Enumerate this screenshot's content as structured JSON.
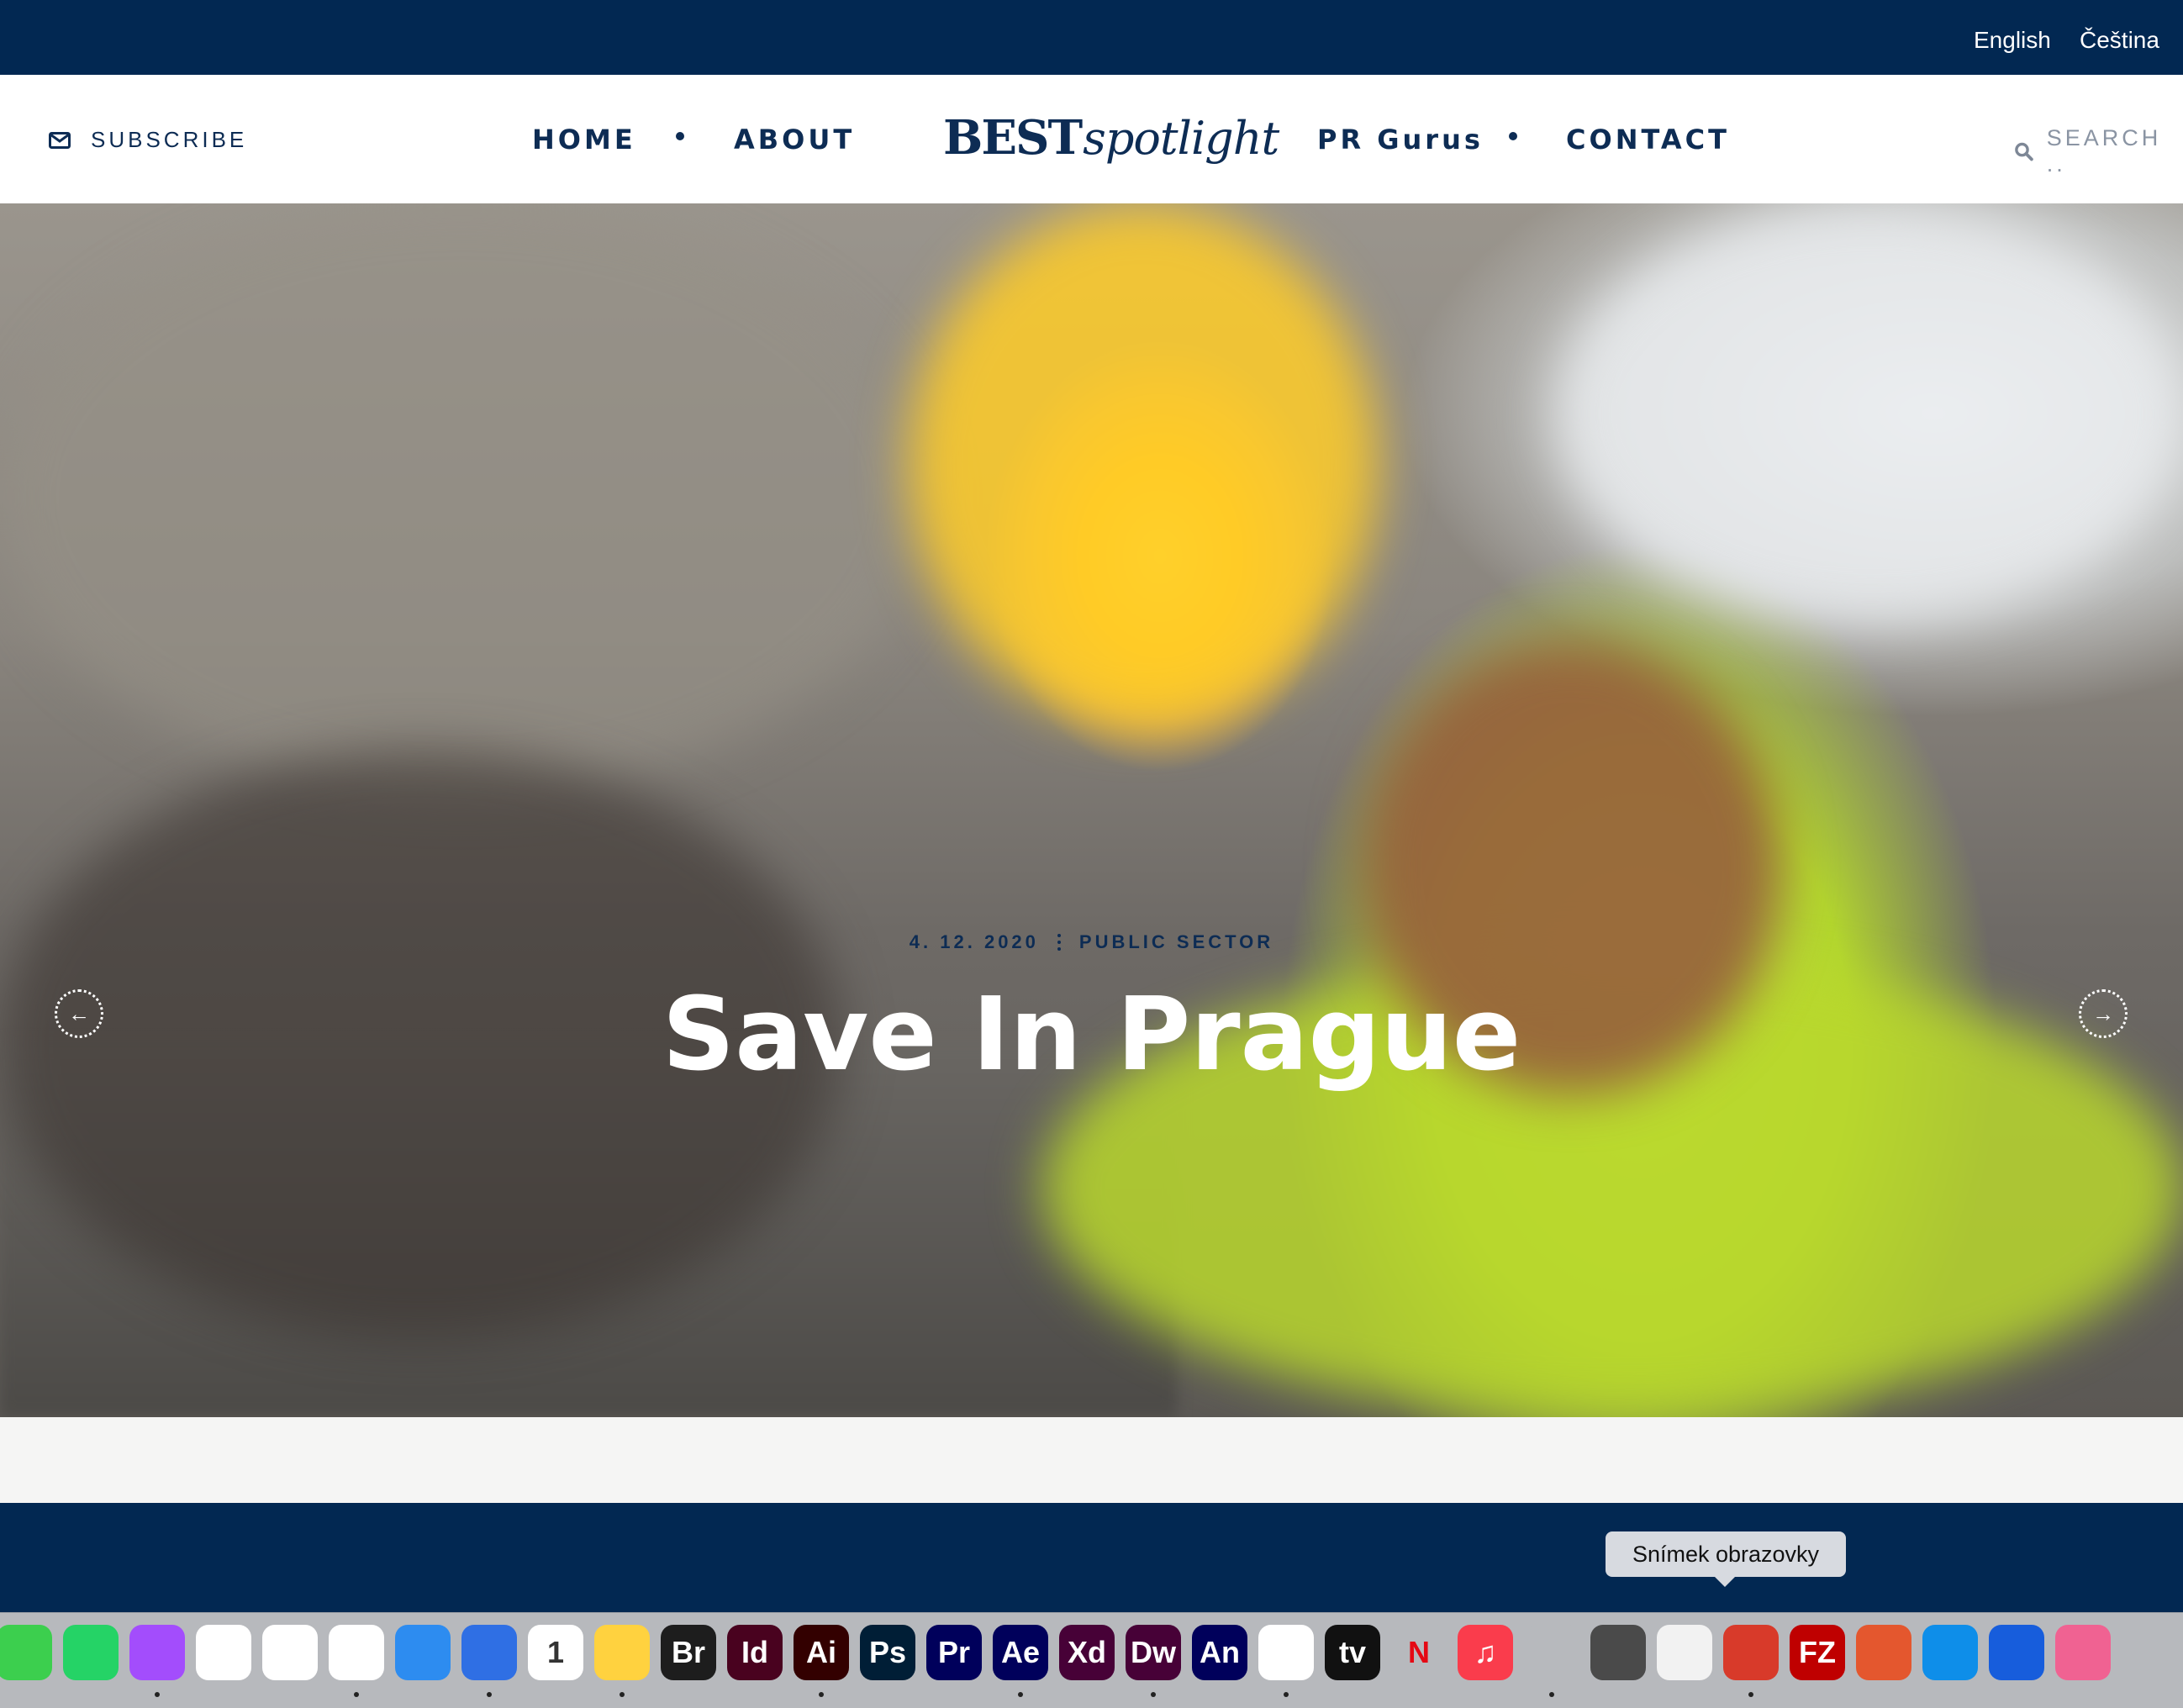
{
  "languages": {
    "english": "English",
    "czech": "Čeština"
  },
  "header": {
    "subscribe": "SUBSCRIBE",
    "nav": {
      "home": "HOME",
      "about": "ABOUT",
      "pr_gurus": "PR Gurus",
      "contact": "CONTACT"
    },
    "logo": {
      "bold": "BEST",
      "script": "spotlight"
    },
    "search_placeholder": "SEARCH .."
  },
  "hero": {
    "date": "4. 12. 2020",
    "category": "PUBLIC SECTOR",
    "title": "Save In Prague",
    "prev_arrow": "←",
    "next_arrow": "→"
  },
  "tooltip": "Snímek obrazovky",
  "dock": {
    "items": [
      {
        "name": "facetime-icon",
        "label": "",
        "color": "#3ccf4e"
      },
      {
        "name": "whatsapp-icon",
        "label": "",
        "color": "#25d366"
      },
      {
        "name": "messenger-icon",
        "label": "",
        "color": "#a34dfc"
      },
      {
        "name": "google-maps-icon",
        "label": "",
        "color": "#ffffff"
      },
      {
        "name": "google-photos-icon",
        "label": "",
        "color": "#ffffff"
      },
      {
        "name": "chrome-icon",
        "label": "",
        "color": "#ffffff"
      },
      {
        "name": "safari-icon",
        "label": "",
        "color": "#2d8cf0"
      },
      {
        "name": "spark-icon",
        "label": "",
        "color": "#2f6fe4"
      },
      {
        "name": "calendar-icon",
        "label": "1",
        "color": "#ffffff"
      },
      {
        "name": "tips-icon",
        "label": "",
        "color": "#ffd23f"
      },
      {
        "name": "bridge-icon",
        "label": "Br",
        "color": "#1d1d1d"
      },
      {
        "name": "indesign-icon",
        "label": "Id",
        "color": "#49021f"
      },
      {
        "name": "illustrator-icon",
        "label": "Ai",
        "color": "#330000"
      },
      {
        "name": "photoshop-icon",
        "label": "Ps",
        "color": "#001e36"
      },
      {
        "name": "premiere-icon",
        "label": "Pr",
        "color": "#00005b"
      },
      {
        "name": "after-effects-icon",
        "label": "Ae",
        "color": "#00005b"
      },
      {
        "name": "xd-icon",
        "label": "Xd",
        "color": "#470137"
      },
      {
        "name": "dreamweaver-icon",
        "label": "Dw",
        "color": "#470137"
      },
      {
        "name": "animate-icon",
        "label": "An",
        "color": "#00005b"
      },
      {
        "name": "home-icon",
        "label": "",
        "color": "#ffffff"
      },
      {
        "name": "apple-tv-icon",
        "label": "tv",
        "color": "#111111"
      },
      {
        "name": "netflix-icon",
        "label": "N",
        "color": "#b7b9bd"
      },
      {
        "name": "music-icon",
        "label": "♫",
        "color": "#fa3c4c"
      },
      {
        "name": "vlc-icon",
        "label": "",
        "color": "#b7b9bd"
      },
      {
        "name": "calculator-icon",
        "label": "",
        "color": "#4a4a4a"
      },
      {
        "name": "screenshot-icon",
        "label": "",
        "color": "#f2f2f2"
      },
      {
        "name": "compass-icon",
        "label": "",
        "color": "#d83a2a"
      },
      {
        "name": "filezilla-icon",
        "label": "FZ",
        "color": "#bf0000"
      },
      {
        "name": "remote-desktop-icon",
        "label": "",
        "color": "#e4572e"
      },
      {
        "name": "teamviewer-icon",
        "label": "",
        "color": "#0e8ee9"
      },
      {
        "name": "bitwarden-icon",
        "label": "",
        "color": "#175ddc"
      },
      {
        "name": "cleanmymac-icon",
        "label": "",
        "color": "#f06292"
      }
    ]
  }
}
